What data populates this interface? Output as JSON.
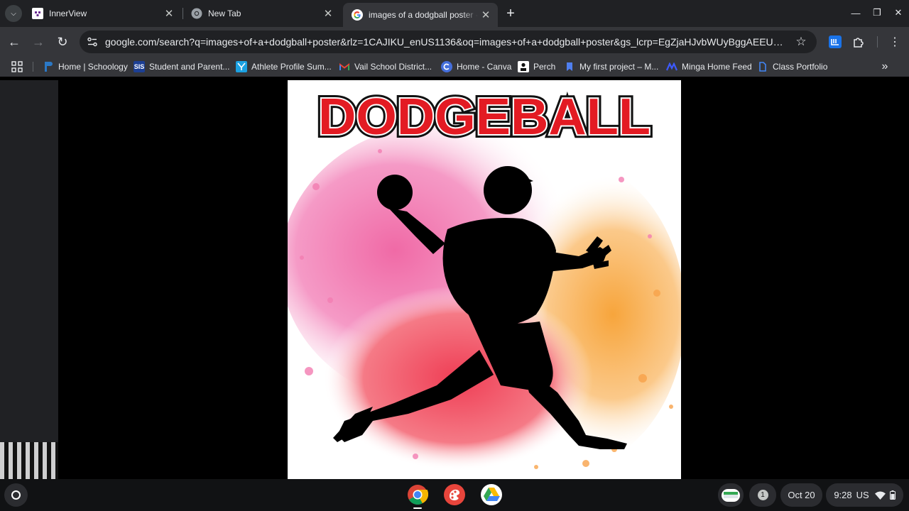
{
  "browser": {
    "tabs": [
      {
        "title": "InnerView",
        "favicon": "innerview-icon",
        "active": false
      },
      {
        "title": "New Tab",
        "favicon": "chrome-icon",
        "active": false
      },
      {
        "title": "images of a dodgball poster - G",
        "favicon": "google-icon",
        "active": true
      }
    ],
    "url": "google.com/search?q=images+of+a+dodgball+poster&rlz=1CAJIKU_enUS1136&oq=images+of+a+dodgball+poster&gs_lcrp=EgZjaHJvbWUyBggAEEUYOTIJCAEQI..."
  },
  "bookmarks": [
    {
      "label": "Home | Schoology",
      "icon": "schoology-icon",
      "color": "#2b78c5"
    },
    {
      "label": "Student and Parent...",
      "icon": "sis-icon",
      "color": "#1c3f94"
    },
    {
      "label": "Athlete Profile Sum...",
      "icon": "athlete-icon",
      "color": "#1ba1e2"
    },
    {
      "label": "Vail School District...",
      "icon": "gmail-icon",
      "color": "#ea4335"
    },
    {
      "label": "Home - Canva",
      "icon": "canva-icon",
      "color": "#7d2ae8"
    },
    {
      "label": "Perch",
      "icon": "perch-icon",
      "color": "#ffffff"
    },
    {
      "label": "My first project – M...",
      "icon": "bookmark-icon",
      "color": "#4f7ff0"
    },
    {
      "label": "Minga Home Feed",
      "icon": "minga-icon",
      "color": "#3d5afe"
    },
    {
      "label": "Class Portfolio",
      "icon": "portfolio-icon",
      "color": "#4285f4"
    }
  ],
  "poster": {
    "title": "DODGEBALL",
    "title_color": "#e31b23"
  },
  "shelf": {
    "apps": [
      "chrome-icon",
      "canvas-paint-icon",
      "google-drive-icon"
    ],
    "notification_count": "1",
    "date": "Oct 20",
    "time": "9:28",
    "locale": "US"
  }
}
